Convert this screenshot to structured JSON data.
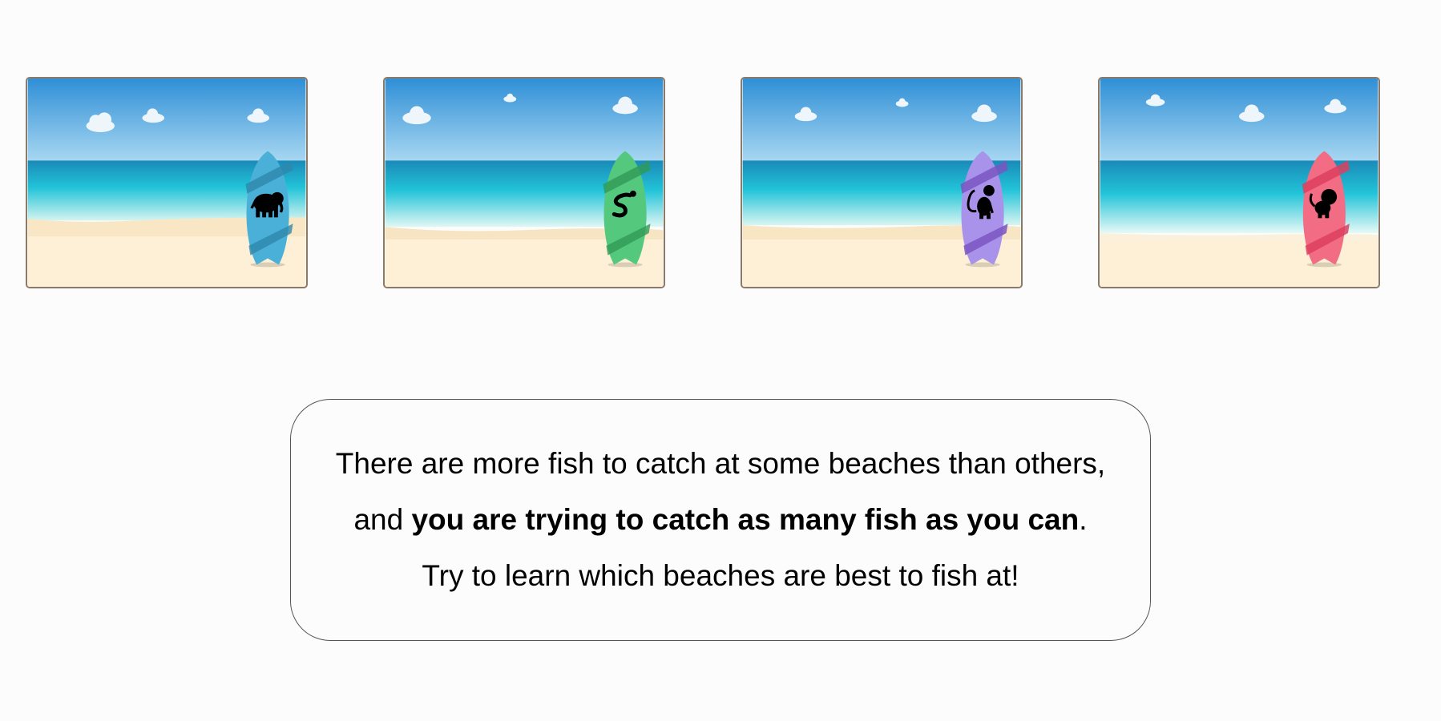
{
  "beaches": [
    {
      "id": "beach-1",
      "animal": "elephant-icon",
      "board_color": "#4ab0d8",
      "stripe_color": "#2e87ad"
    },
    {
      "id": "beach-2",
      "animal": "snake-icon",
      "board_color": "#54c97e",
      "stripe_color": "#2f9a55"
    },
    {
      "id": "beach-3",
      "animal": "monkey-icon",
      "board_color": "#a992ea",
      "stripe_color": "#7a55c2"
    },
    {
      "id": "beach-4",
      "animal": "lion-icon",
      "board_color": "#f26c84",
      "stripe_color": "#dd3f5e"
    }
  ],
  "instructions": {
    "line1": "There are more fish to catch at some beaches than others,",
    "line2_prefix": "and ",
    "line2_bold": "you are trying to catch as many fish as you can",
    "line2_suffix": ".",
    "line3": "Try to learn which beaches are best to fish at!"
  },
  "colors": {
    "sky_top": "#2f8fd6",
    "sky_bottom": "#a9d8f2",
    "sea": "#22b9d4",
    "sand": "#fdf0d7"
  }
}
